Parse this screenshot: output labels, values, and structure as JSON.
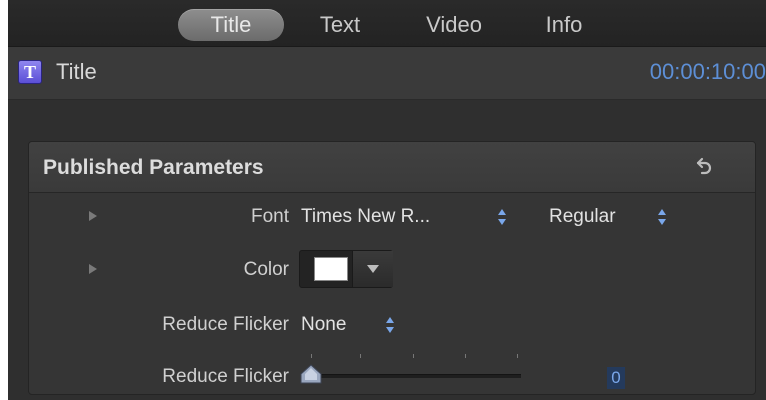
{
  "tabs": [
    {
      "label": "Title",
      "active": true
    },
    {
      "label": "Text",
      "active": false
    },
    {
      "label": "Video",
      "active": false
    },
    {
      "label": "Info",
      "active": false
    }
  ],
  "header": {
    "icon": "title-t-icon",
    "icon_letter": "T",
    "title": "Title",
    "timecode": "00:00:10:00"
  },
  "section": {
    "title": "Published Parameters",
    "reset_icon": "reset-icon"
  },
  "params": {
    "font": {
      "label": "Font",
      "family": "Times New R...",
      "style": "Regular"
    },
    "color": {
      "label": "Color",
      "swatch_color": "#ffffff"
    },
    "reduce_flicker_popup": {
      "label": "Reduce Flicker",
      "value": "None"
    },
    "reduce_flicker_slider": {
      "label": "Reduce Flicker",
      "value": "0"
    }
  },
  "colors": {
    "accent_blue": "#5d8fd6",
    "panel_bg": "#2f2f2f"
  }
}
